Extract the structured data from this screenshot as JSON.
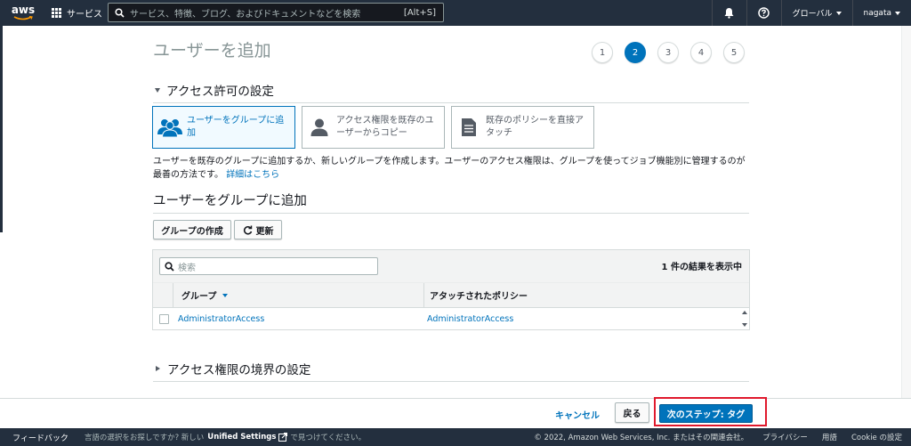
{
  "nav": {
    "logo_text": "aws",
    "services_label": "サービス",
    "search_placeholder": "サービス、特徴、ブログ、およびドキュメントなどを検索",
    "search_shortcut": "[Alt+S]",
    "region_label": "グローバル",
    "user_label": "nagata"
  },
  "page": {
    "title": "ユーザーを追加",
    "steps": [
      "1",
      "2",
      "3",
      "4",
      "5"
    ],
    "active_step": 2
  },
  "permissions": {
    "section_title": "アクセス許可の設定",
    "options": [
      {
        "label": "ユーザーをグループに追加",
        "icon": "group-icon",
        "selected": true
      },
      {
        "label": "アクセス権限を既存のユーザーからコピー",
        "icon": "user-icon",
        "selected": false
      },
      {
        "label": "既存のポリシーを直接アタッチ",
        "icon": "document-icon",
        "selected": false
      }
    ],
    "description": "ユーザーを既存のグループに追加するか、新しいグループを作成します。ユーザーのアクセス権限は、グループを使ってジョブ機能別に管理するのが最善の方法です。",
    "details_link": "詳細はこちら"
  },
  "group_section": {
    "title": "ユーザーをグループに追加",
    "create_group_button": "グループの作成",
    "refresh_button": "更新",
    "search_placeholder": "検索",
    "result_count": "1 件の結果を表示中",
    "columns": [
      "グループ",
      "アタッチされたポリシー"
    ],
    "rows": [
      {
        "group": "AdministratorAccess",
        "policy": "AdministratorAccess",
        "checked": false
      }
    ]
  },
  "boundary": {
    "section_title": "アクセス権限の境界の設定"
  },
  "actions": {
    "cancel": "キャンセル",
    "back": "戻る",
    "next": "次のステップ: タグ"
  },
  "footer": {
    "feedback": "フィードバック",
    "language_prompt": "言語の選択をお探しですか? 新しい",
    "unified_settings": "Unified Settings",
    "language_suffix": "で見つけてください。",
    "copyright": "© 2022, Amazon Web Services, Inc. またはその関連会社。",
    "privacy": "プライバシー",
    "terms": "用語",
    "cookie": "Cookie の設定"
  },
  "colors": {
    "nav_bg": "#232f3e",
    "accent": "#0073bb",
    "highlight_box": "#e0192d"
  }
}
